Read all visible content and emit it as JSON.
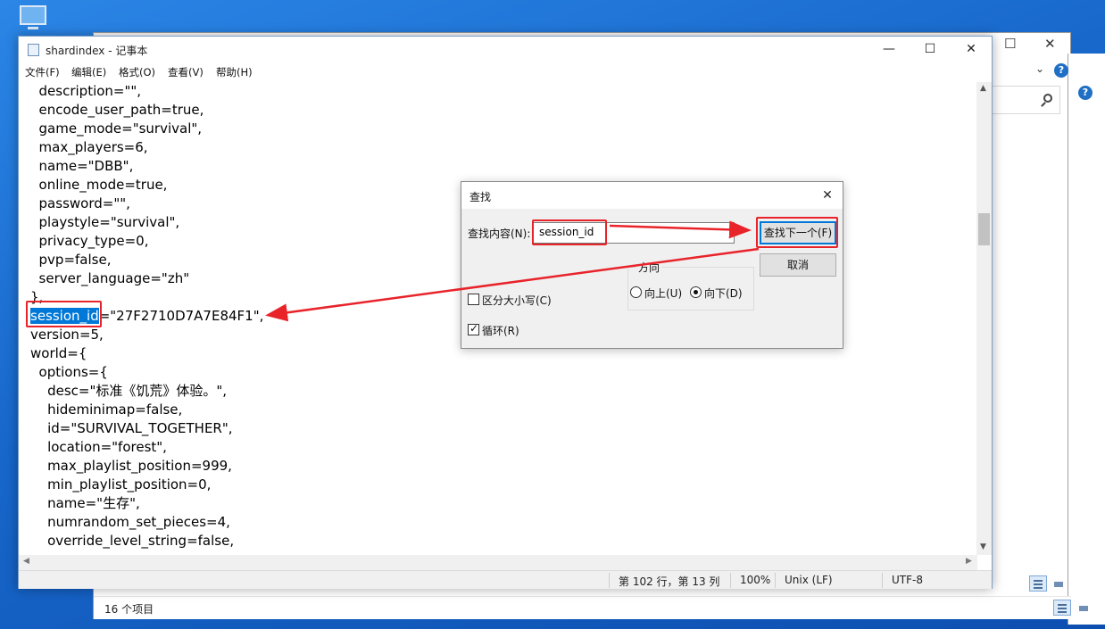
{
  "notepad": {
    "title": "shardindex - 记事本",
    "menu": [
      "文件(F)",
      "编辑(E)",
      "格式(O)",
      "查看(V)",
      "帮助(H)"
    ],
    "lines": [
      "  description=\"\",",
      "  encode_user_path=true,",
      "  game_mode=\"survival\",",
      "  max_players=6,",
      "  name=\"DBB\",",
      "  online_mode=true,",
      "  password=\"\",",
      "  playstyle=\"survival\",",
      "  privacy_type=0,",
      "  pvp=false,",
      "  server_language=\"zh\"",
      "},",
      "",
      "version=5,",
      "world={",
      "  options={",
      "    desc=\"标准《饥荒》体验。\",",
      "    hideminimap=false,",
      "    id=\"SURVIVAL_TOGETHER\",",
      "    location=\"forest\",",
      "    max_playlist_position=999,",
      "    min_playlist_position=0,",
      "    name=\"生存\",",
      "    numrandom_set_pieces=4,",
      "    override_level_string=false,"
    ],
    "selected_line": {
      "selected": "session_id",
      "rest": "=\"27F2710D7A7E84F1\","
    },
    "status": {
      "position": "第 102 行，第 13 列",
      "zoom": "100%",
      "eol": "Unix (LF)",
      "encoding": "UTF-8"
    }
  },
  "find_dialog": {
    "title": "查找",
    "find_label": "查找内容(N):",
    "find_value": "session_id",
    "find_next": "查找下一个(F)",
    "cancel": "取消",
    "direction_label": "方向",
    "up": "向上(U)",
    "down": "向下(D)",
    "match_case": "区分大小写(C)",
    "wrap": "循环(R)",
    "match_case_checked": false,
    "wrap_checked": true,
    "direction": "down"
  },
  "explorer": {
    "status": "16 个项目"
  },
  "colors": {
    "annotation": "#e8232a",
    "selection": "#0078d7"
  }
}
